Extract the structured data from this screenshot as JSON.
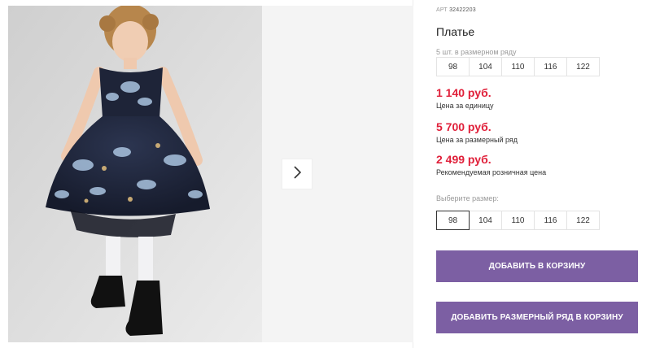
{
  "product": {
    "article_label": "АРТ",
    "article_number": "32422203",
    "title": "Платье",
    "pack_note": "5 шт. в размерном ряду",
    "pack_sizes": [
      "98",
      "104",
      "110",
      "116",
      "122"
    ]
  },
  "prices": [
    {
      "value": "1 140 руб.",
      "caption": "Цена за единицу"
    },
    {
      "value": "5 700 руб.",
      "caption": "Цена за размерный ряд"
    },
    {
      "value": "2 499 руб.",
      "caption": "Рекомендуемая розничная цена"
    }
  ],
  "size_select": {
    "label": "Выберите размер:",
    "options": [
      "98",
      "104",
      "110",
      "116",
      "122"
    ],
    "selected": "98"
  },
  "actions": {
    "add_to_cart": "ДОБАВИТЬ В КОРЗИНУ",
    "add_pack_to_cart": "ДОБАВИТЬ РАЗМЕРНЫЙ РЯД В КОРЗИНУ"
  },
  "gallery": {
    "next_icon": "chevron-right-icon"
  },
  "colors": {
    "price": "#e0203a",
    "button": "#7c5fa3"
  }
}
